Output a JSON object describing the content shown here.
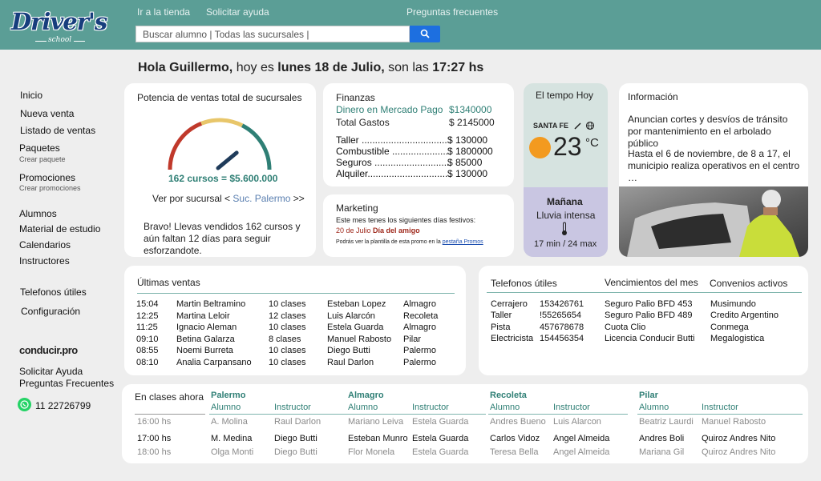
{
  "brand": {
    "name": "Driver's",
    "tagline": "school"
  },
  "nav": {
    "store": "Ir a la tienda",
    "help": "Solicitar ayuda",
    "faq": "Preguntas frecuentes"
  },
  "search": {
    "placeholder": "Buscar alumno   |  Todas las sucursales  |"
  },
  "greeting": {
    "pre": "Hola ",
    "name": "Guillermo,",
    "mid": " hoy es ",
    "date": "lunes 18 de Julio,",
    "mid2": " son las ",
    "time": "17:27 hs"
  },
  "sidebar": {
    "items": [
      {
        "label": "Inicio"
      },
      {
        "label": "Nueva venta"
      },
      {
        "label": "Listado de ventas"
      },
      {
        "label": "Paquetes",
        "sub": "Crear paquete"
      },
      {
        "label": "Promociones",
        "sub": "Crear promociones"
      },
      {
        "label": "Alumnos"
      },
      {
        "label": "Material de estudio"
      },
      {
        "label": "Calendarios"
      },
      {
        "label": "Instructores"
      },
      {
        "label": "Telefonos útiles"
      },
      {
        "label": "Configuración"
      }
    ],
    "partner": "conducir.pro",
    "help": "Solicitar Ayuda",
    "faq": "Preguntas Frecuentes",
    "phone": "11 22726799"
  },
  "sales_power": {
    "title": "Potencia de ventas total de sucursales",
    "gauge_level": 0.78,
    "value_text": "162 cursos = $5.600.000",
    "branch_pre": "Ver por sucursal < ",
    "branch": "Suc. Palermo",
    "branch_post": " >>",
    "message": "Bravo! Llevas vendidos 162 cursos  y aún faltan 12 días para seguir esforzandote.",
    "colors": {
      "low": "#c0392b",
      "mid": "#e8c66a",
      "high": "#2f7f75"
    }
  },
  "finance": {
    "title": "Finanzas",
    "mp_label": "Dinero en Mercado Pago",
    "mp_value": "$1340000",
    "total_label": "Total Gastos",
    "total_value": "$ 2145000",
    "items": [
      {
        "label": "Taller ........................................",
        "value": "$ 130000"
      },
      {
        "label": "Combustible ..............................",
        "value": "$ 1800000"
      },
      {
        "label": "Seguros ...........................................",
        "value": "$ 85000"
      },
      {
        "label": "Alquiler........................................",
        "value": "$ 130000"
      }
    ]
  },
  "marketing": {
    "title": "Marketing",
    "line1": "Este mes tenes los siguientes días festivos:",
    "date": "20 de Julio ",
    "event": "Día del amigo",
    "line3": "Podrás ver la plantilla de esta promo en la ",
    "link": "pestaña Promos"
  },
  "weather": {
    "title": "El tempo Hoy",
    "city": "SANTA FE",
    "temp": "23",
    "unit": "°C",
    "tomorrow": "Mañana",
    "forecast": "Lluvia intensa",
    "range": "17 min / 24 max"
  },
  "info": {
    "title": "Información",
    "p1": "Anuncian cortes y desvíos de tránsito por mantenimiento en el arbolado público",
    "p2": "Hasta el 6 de noviembre, de 8 a 17, el municipio realiza operativos en el centro …",
    "photo": "traffic-officer-photo"
  },
  "sales": {
    "title": "Últimas ventas",
    "rows": [
      [
        "15:04",
        "Martin Beltramino",
        "10 clases",
        "Esteban Lopez",
        "Almagro"
      ],
      [
        "12:25",
        "Martina Leloir",
        "12 clases",
        "Luis Alarcón",
        "Recoleta"
      ],
      [
        "11:25",
        "Ignacio Aleman",
        "10 clases",
        "Estela Guarda",
        "Almagro"
      ],
      [
        "09:10",
        "Betina Galarza",
        "8  clases",
        "Manuel Rabosto",
        "Pilar"
      ],
      [
        "08:55",
        "Noemi Burreta",
        "10 clases",
        "Diego Butti",
        "Palermo"
      ],
      [
        "08:10",
        "Analia Carpansano",
        "10 clases",
        "Raul Darlon",
        "Palermo"
      ]
    ]
  },
  "phones": {
    "title": "Telefonos útiles",
    "rows": [
      [
        "Cerrajero",
        "153426761"
      ],
      [
        "Taller",
        "!55265654"
      ],
      [
        "Pista",
        "457678678"
      ],
      [
        "Electricista",
        "154456354"
      ]
    ]
  },
  "expirations": {
    "title": "Vencimientos del mes",
    "rows": [
      "Seguro Palio BFD 453",
      "Seguro Palio BFD 489",
      "Cuota Clio",
      "Licencia Conducir Butti"
    ]
  },
  "agreements": {
    "title": "Convenios activos",
    "rows": [
      "Musimundo",
      "Credito Argentino",
      "Conmega",
      "Megalogistica"
    ]
  },
  "classes": {
    "title": "En clases ahora",
    "times": [
      "16:00 hs",
      "17:00 hs",
      "18:00 hs"
    ],
    "col_student": "Alumno",
    "col_instructor": "Instructor",
    "branches": [
      {
        "name": "Palermo",
        "rows": [
          [
            "A. Molina",
            "Raul Darlon"
          ],
          [
            "M. Medina",
            "Diego Butti"
          ],
          [
            "Olga Monti",
            "Diego Butti"
          ]
        ]
      },
      {
        "name": "Almagro",
        "rows": [
          [
            "Mariano Leiva",
            "Estela Guarda"
          ],
          [
            "Esteban Munro",
            "Estela Guarda"
          ],
          [
            "Flor Monela",
            "Estela Guarda"
          ]
        ]
      },
      {
        "name": "Recoleta",
        "rows": [
          [
            "Andres Bueno",
            "Luis Alarcon"
          ],
          [
            "Carlos Vidoz",
            "Angel Almeida"
          ],
          [
            "Teresa Bella",
            "Angel Almeida"
          ]
        ]
      },
      {
        "name": "Pilar",
        "rows": [
          [
            "Beatriz Laurdi",
            "Manuel Rabosto"
          ],
          [
            "Andres Boli",
            "Quiroz Andres Nito"
          ],
          [
            "Mariana Gil",
            "Quiroz Andres Nito"
          ]
        ]
      }
    ]
  }
}
